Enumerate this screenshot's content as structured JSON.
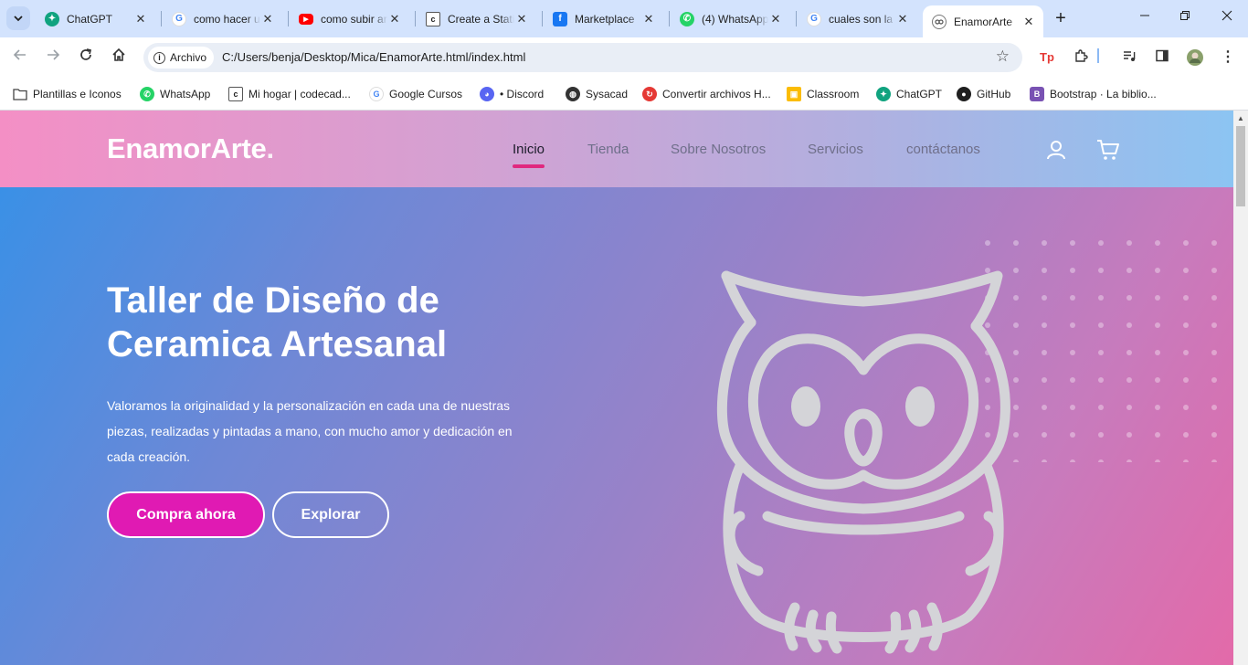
{
  "browser": {
    "tabs": [
      {
        "title": "ChatGPT",
        "icon": "chatgpt-icon",
        "color": "#10a37f"
      },
      {
        "title": "como hacer una",
        "icon": "google-icon",
        "color": "#4285f4"
      },
      {
        "title": "como subir ar",
        "icon": "youtube-icon",
        "color": "#ff0000"
      },
      {
        "title": "Create a Static",
        "icon": "codecademy-icon",
        "color": "#1f1f1f"
      },
      {
        "title": "Marketplace",
        "icon": "facebook-icon",
        "color": "#1877f2"
      },
      {
        "title": "(4) WhatsApp",
        "icon": "whatsapp-icon",
        "color": "#25d366"
      },
      {
        "title": "cuales son la",
        "icon": "google-icon",
        "color": "#4285f4"
      },
      {
        "title": "EnamorArte",
        "icon": "owl-icon",
        "color": "#555555"
      }
    ],
    "address": {
      "chip_label": "Archivo",
      "url": "C:/Users/benja/Desktop/Mica/EnamorArte.html/index.html"
    },
    "bookmarks": [
      {
        "label": "Plantillas e Iconos",
        "icon": "folder-icon"
      },
      {
        "label": "WhatsApp",
        "icon": "whatsapp-icon"
      },
      {
        "label": "Mi hogar | codecad...",
        "icon": "codecademy-icon"
      },
      {
        "label": "Google Cursos",
        "icon": "google-icon"
      },
      {
        "label": "• Discord",
        "icon": "discord-icon"
      },
      {
        "label": "Sysacad",
        "icon": "globe-icon"
      },
      {
        "label": "Convertir archivos H...",
        "icon": "convert-icon"
      },
      {
        "label": "Classroom",
        "icon": "classroom-icon"
      },
      {
        "label": "ChatGPT",
        "icon": "chatgpt-icon"
      },
      {
        "label": "GitHub",
        "icon": "github-icon"
      },
      {
        "label": "Bootstrap · La biblio...",
        "icon": "bootstrap-icon"
      }
    ]
  },
  "site": {
    "logo": "EnamorArte",
    "logo_dot": ".",
    "nav": [
      {
        "label": "Inicio",
        "active": true
      },
      {
        "label": "Tienda"
      },
      {
        "label": "Sobre Nosotros"
      },
      {
        "label": "Servicios"
      },
      {
        "label": "contáctanos"
      }
    ],
    "hero": {
      "title": "Taller de Diseño de Ceramica Artesanal",
      "text": "Valoramos la originalidad y la personalización en cada una de nuestras piezas, realizadas y pintadas a mano, con mucho amor y dedicación en cada creación.",
      "primary_button": "Compra ahora",
      "secondary_button": "Explorar"
    },
    "colors": {
      "accent": "#e01ab3",
      "nav_underline": "#e0287f",
      "owl_stroke": "#d4d4d8"
    }
  }
}
